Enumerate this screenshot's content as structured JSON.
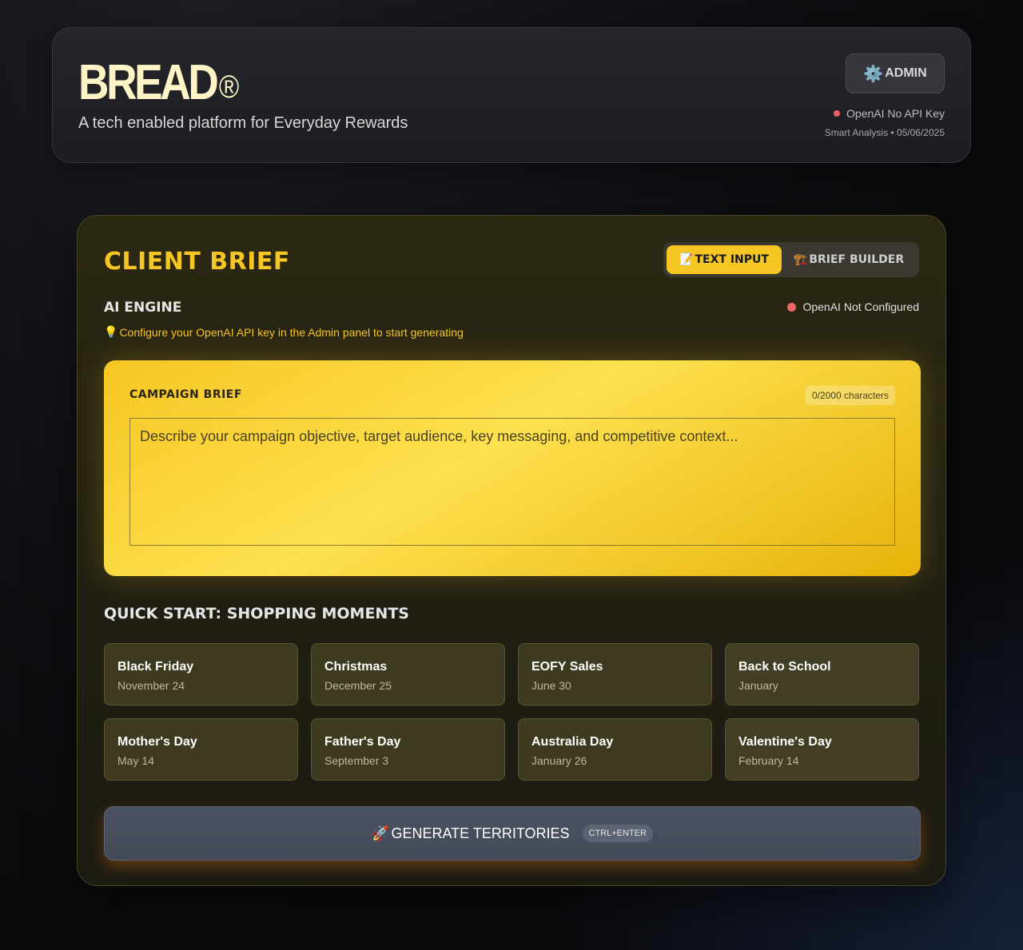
{
  "header": {
    "brand": "BREAD",
    "brand_mark": "®",
    "tagline": "A tech enabled platform for Everyday Rewards",
    "admin_label": "ADMIN",
    "admin_icon": "⚙️",
    "api_status": "OpenAI No API Key",
    "smart_analysis": "Smart Analysis • 05/06/2025"
  },
  "client_brief": {
    "title": "CLIENT BRIEF",
    "tabs": [
      {
        "icon": "📝",
        "label": "TEXT INPUT",
        "active": true
      },
      {
        "icon": "🏗️",
        "label": "BRIEF BUILDER",
        "active": false
      }
    ],
    "ai_engine_label": "AI ENGINE",
    "ai_status": "OpenAI Not Configured",
    "hint_icon": "💡",
    "hint": "Configure your OpenAI API key in the Admin panel to start generating",
    "campaign_label": "CAMPAIGN BRIEF",
    "char_count": "0/2000 characters",
    "brief_value": "",
    "brief_placeholder": "Describe your campaign objective, target audience, key messaging, and competitive context..."
  },
  "quick_start": {
    "title": "QUICK START: SHOPPING MOMENTS",
    "moments": [
      {
        "name": "Black Friday",
        "date": "November 24"
      },
      {
        "name": "Christmas",
        "date": "December 25"
      },
      {
        "name": "EOFY Sales",
        "date": "June 30"
      },
      {
        "name": "Back to School",
        "date": "January"
      },
      {
        "name": "Mother's Day",
        "date": "May 14"
      },
      {
        "name": "Father's Day",
        "date": "September 3"
      },
      {
        "name": "Australia Day",
        "date": "January 26"
      },
      {
        "name": "Valentine's Day",
        "date": "February 14"
      }
    ]
  },
  "generate": {
    "icon": "🚀",
    "label": "GENERATE TERRITORIES",
    "shortcut": "CTRL+ENTER"
  },
  "colors": {
    "accent": "#f6c623",
    "status_error": "#ef5e5e"
  }
}
